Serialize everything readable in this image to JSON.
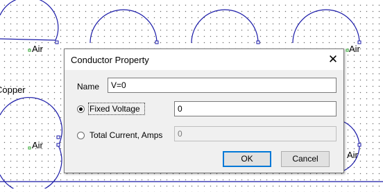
{
  "canvas": {
    "labels": [
      "Air",
      "Air",
      "Air",
      "Air",
      "Copper"
    ]
  },
  "dialog": {
    "title": "Conductor Property",
    "close_icon": "close-icon",
    "name_label": "Name",
    "name_value": "V=0",
    "fixed_voltage_label": "Fixed Voltage",
    "fixed_voltage_value": "0",
    "fixed_voltage_checked": true,
    "total_current_label": "Total Current, Amps",
    "total_current_value": "0",
    "total_current_checked": false,
    "ok_label": "OK",
    "cancel_label": "Cancel"
  },
  "colors": {
    "geometry_line": "#1a1aa8",
    "node_marker": "#2fa82f",
    "default_button_border": "#0078d7"
  }
}
